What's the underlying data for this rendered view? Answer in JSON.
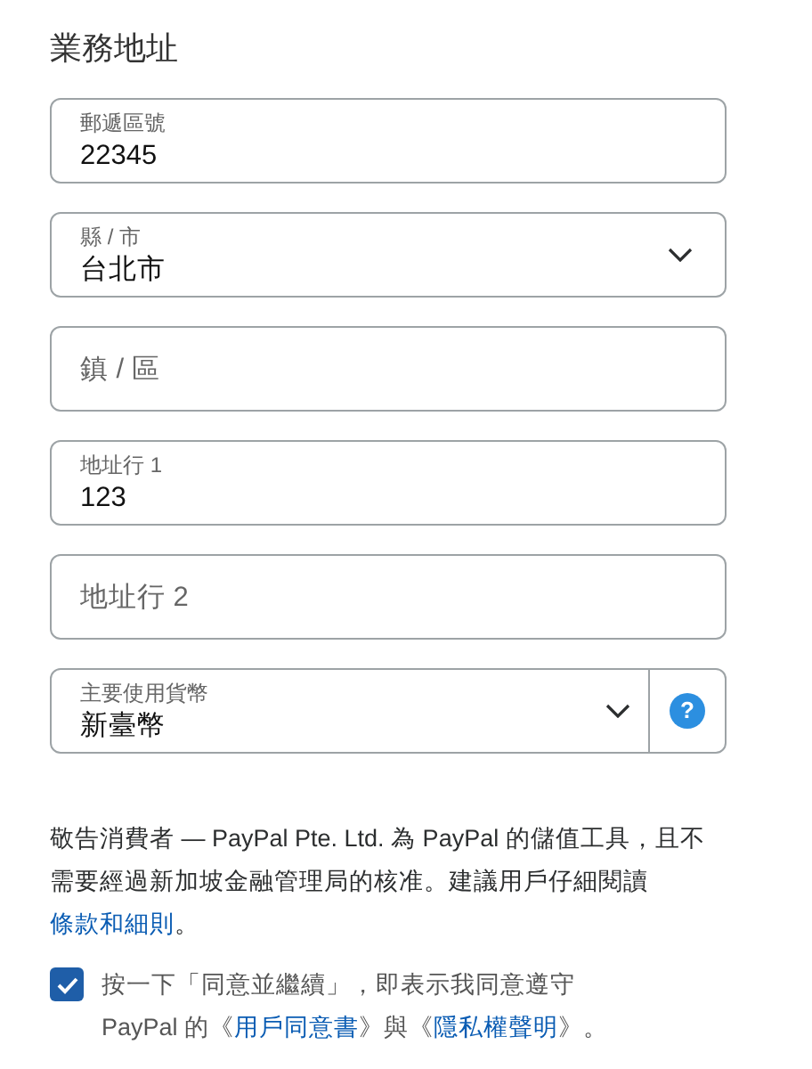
{
  "heading": "業務地址",
  "fields": [
    {
      "kind": "input",
      "label": "郵遞區號",
      "value": "22345"
    },
    {
      "kind": "select",
      "label": "縣 / 市",
      "value": "台北市"
    },
    {
      "kind": "input",
      "placeholder": "鎮 / 區"
    },
    {
      "kind": "input",
      "label": "地址行 1",
      "value": "123"
    },
    {
      "kind": "input",
      "placeholder": "地址行 2"
    },
    {
      "kind": "select_help",
      "label": "主要使用貨幣",
      "value": "新臺幣",
      "help": "?"
    }
  ],
  "notice": [
    {
      "kind": "text",
      "text": "敬告消費者 — PayPal Pte. Ltd. 為 PayPal 的儲值工具，且不需要經過新加坡金融管理局的核准。建議用戶仔細閱讀"
    },
    {
      "kind": "link",
      "text": "條款和細則"
    },
    {
      "kind": "text",
      "text": "。"
    }
  ],
  "agreement": {
    "checked": true,
    "parts": [
      {
        "kind": "text",
        "text": "按一下「同意並繼續」，即表示我同意遵守 PayPal 的《"
      },
      {
        "kind": "link",
        "text": "用戶同意書"
      },
      {
        "kind": "text",
        "text": "》與《"
      },
      {
        "kind": "link",
        "text": "隱私權聲明"
      },
      {
        "kind": "text",
        "text": "》。"
      }
    ]
  }
}
